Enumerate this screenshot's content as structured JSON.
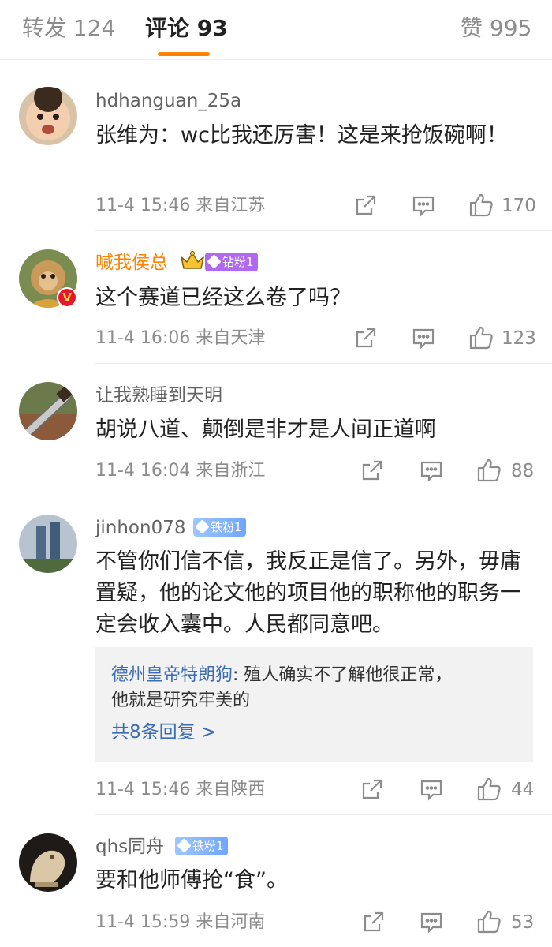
{
  "tabs": {
    "repost": "转发 124",
    "comments": "评论 93",
    "likes": "赞 995"
  },
  "comments": [
    {
      "username": "hdhanguan_25a",
      "text": "张维为：wc比我还厉害！这是来抢饭碗啊！",
      "time_location": "11-4 15:46 来自江苏",
      "likes": "170"
    },
    {
      "username": "喊我侯总",
      "fan_badge": "钻粉1",
      "text": "这个赛道已经这么卷了吗？",
      "time_location": "11-4 16:06 来自天津",
      "likes": "123"
    },
    {
      "username": "让我熟睡到天明",
      "text": "胡说八道、颠倒是非才是人间正道啊",
      "time_location": "11-4 16:04 来自浙江",
      "likes": "88"
    },
    {
      "username": "jinhon078",
      "fan_badge": "铁粉1",
      "text": "不管你们信不信，我反正是信了。另外，毋庸置疑，他的论文他的项目他的职称他的职务一定会收入囊中。人民都同意吧。",
      "reply": {
        "author": "德州皇帝特朗狗",
        "text_line1": ": 殖人确实不了解他很正常，",
        "text_line2": "他就是研究牢美的",
        "more": "共8条回复 >"
      },
      "time_location": "11-4 15:46 来自陕西",
      "likes": "44"
    },
    {
      "username": "qhs同舟",
      "fan_badge": "铁粉1",
      "text": "要和他师傅抢“食”。",
      "time_location": "11-4 15:59 来自河南",
      "likes": "53"
    }
  ],
  "colors": {
    "accent": "#ff8200",
    "link": "#3a6db4",
    "muted": "#8c8c8c",
    "vip_name": "#ff8200"
  },
  "icons": [
    "share-icon",
    "comment-icon",
    "like-icon",
    "crown-icon",
    "verified-badge-icon",
    "diamond-icon"
  ]
}
